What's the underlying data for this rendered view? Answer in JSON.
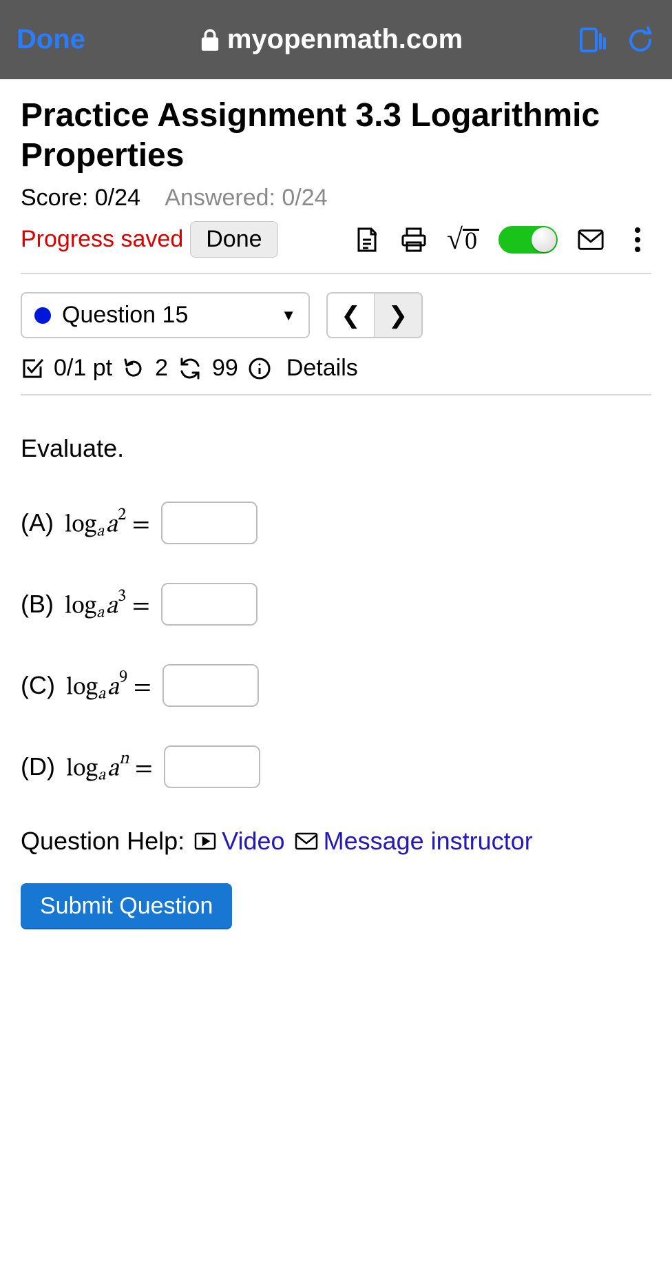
{
  "browser": {
    "done": "Done",
    "url": "myopenmath.com"
  },
  "page": {
    "title": "Practice Assignment 3.3 Logarithmic Properties",
    "score_label": "Score: 0/24",
    "answered_label": "Answered: 0/24",
    "progress_saved": "Progress saved",
    "done_button": "Done"
  },
  "question_nav": {
    "current": "Question 15"
  },
  "meta": {
    "points": "0/1 pt",
    "tries": "2",
    "attempts_allowed": "99",
    "details": "Details"
  },
  "prompt": "Evaluate.",
  "parts": [
    {
      "letter": "(A)",
      "exp": "2"
    },
    {
      "letter": "(B)",
      "exp": "3"
    },
    {
      "letter": "(C)",
      "exp": "9"
    },
    {
      "letter": "(D)",
      "exp": "n"
    }
  ],
  "help": {
    "label": "Question Help:",
    "video": "Video",
    "message": "Message instructor"
  },
  "submit": "Submit Question"
}
